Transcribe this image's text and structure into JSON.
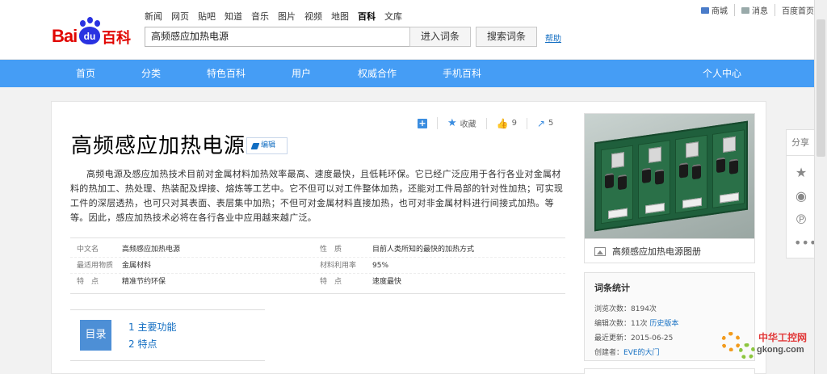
{
  "header": {
    "logo_text": "Baidu百科",
    "topnav": [
      "新闻",
      "网页",
      "贴吧",
      "知道",
      "音乐",
      "图片",
      "视频",
      "地图",
      "百科",
      "文库"
    ],
    "active_nav": "百科",
    "search_value": "高频感应加热电源",
    "enter_button": "进入词条",
    "search_button": "搜索词条",
    "help_link": "帮助",
    "user_links": [
      "商城",
      "消息",
      "百度首页"
    ]
  },
  "navbar": {
    "items": [
      "首页",
      "分类",
      "特色百科",
      "用户",
      "权威合作",
      "手机百科"
    ],
    "right_item": "个人中心",
    "color": "#459df5"
  },
  "entry": {
    "actions": {
      "collect": "收藏",
      "likes": "9",
      "shares": "5"
    },
    "title": "高频感应加热电源",
    "edit_label": "编辑",
    "summary": "高频电源及感应加热技术目前对金属材料加热效率最高、速度最快，且低耗环保。它已经广泛应用于各行各业对金属材料的热加工、热处理、热装配及焊接、熔炼等工艺中。它不但可以对工件整体加热，还能对工件局部的针对性加热；可实现工件的深层透热，也可只对其表面、表层集中加热；不但可对金属材料直接加热，也可对非金属材料进行间接式加热。等等。因此，感应加热技术必将在各行各业中应用越来越广泛。",
    "info": [
      {
        "k1": "中文名",
        "v1": "高频感应加热电源",
        "k2": "性　质",
        "v2": "目前人类所知的最快的加热方式"
      },
      {
        "k1": "最适用物质",
        "v1": "金属材料",
        "k2": "材料利用率",
        "v2": "95%"
      },
      {
        "k1": "特　点",
        "v1": "精准节约环保",
        "k2": "特　点",
        "v2": "速度最快"
      }
    ],
    "toc_label": "目录",
    "toc_items": [
      "1 主要功能",
      "2 特点"
    ]
  },
  "album": {
    "caption": "高频感应加热电源图册"
  },
  "stats": {
    "title": "词条统计",
    "views_label": "浏览次数：",
    "views": "8194次",
    "edits_label": "编辑次数：",
    "edits": "11次",
    "history_link": "历史版本",
    "updated_label": "最近更新：",
    "updated": "2015-06-25",
    "creator_label": "创建者：",
    "creator": "EVE的大门"
  },
  "sidebar": {
    "share": "分享",
    "icons": [
      "star-icon",
      "weibo-icon",
      "pinterest-icon",
      "more-icon"
    ]
  },
  "watermark": {
    "cn": "中华工控网",
    "en": "gkong.com"
  }
}
